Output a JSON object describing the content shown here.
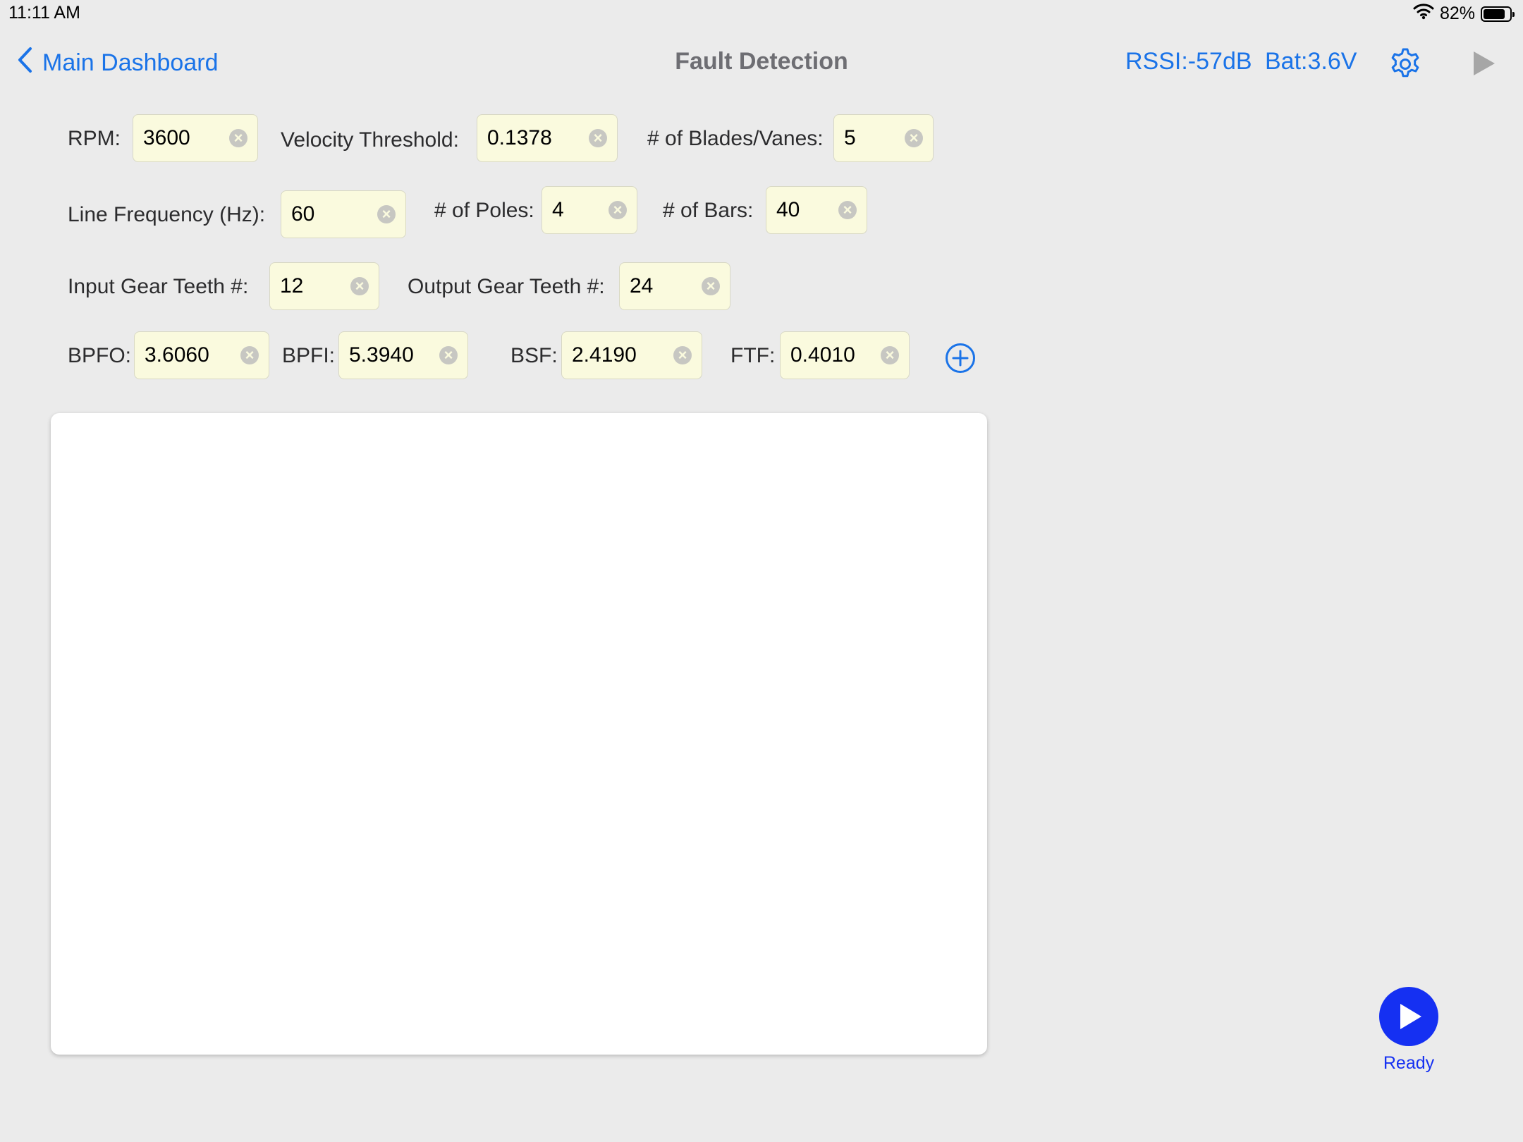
{
  "status_bar": {
    "time": "11:11 AM",
    "battery_percent": "82%",
    "battery_level": 0.82
  },
  "nav": {
    "back_label": "Main Dashboard",
    "title": "Fault Detection",
    "rssi": "RSSI:-57dB",
    "battery": "Bat:3.6V"
  },
  "form": {
    "rpm": {
      "label": "RPM:",
      "value": "3600"
    },
    "velocity_threshold": {
      "label": "Velocity Threshold:",
      "value": "0.1378"
    },
    "blades_vanes": {
      "label": "# of Blades/Vanes:",
      "value": "5"
    },
    "line_frequency": {
      "label": "Line Frequency (Hz):",
      "value": "60"
    },
    "poles": {
      "label": "# of Poles:",
      "value": "4"
    },
    "bars": {
      "label": "# of Bars:",
      "value": "40"
    },
    "input_gear_teeth": {
      "label": "Input Gear Teeth #:",
      "value": "12"
    },
    "output_gear_teeth": {
      "label": "Output Gear Teeth #:",
      "value": "24"
    },
    "bpfo": {
      "label": "BPFO:",
      "value": "3.6060"
    },
    "bpfi": {
      "label": "BPFI:",
      "value": "5.3940"
    },
    "bsf": {
      "label": "BSF:",
      "value": "2.4190"
    },
    "ftf": {
      "label": "FTF:",
      "value": "0.4010"
    }
  },
  "run": {
    "status": "Ready"
  },
  "colors": {
    "accent": "#1a73e8",
    "run_button": "#1530f2",
    "field_bg": "#fafade",
    "background": "#ebebeb"
  },
  "icons": {
    "back": "chevron-left-icon",
    "settings": "gear-icon",
    "play": "play-icon",
    "add": "plus-circle-icon",
    "clear": "clear-x-icon",
    "wifi": "wifi-icon",
    "battery": "battery-icon"
  }
}
